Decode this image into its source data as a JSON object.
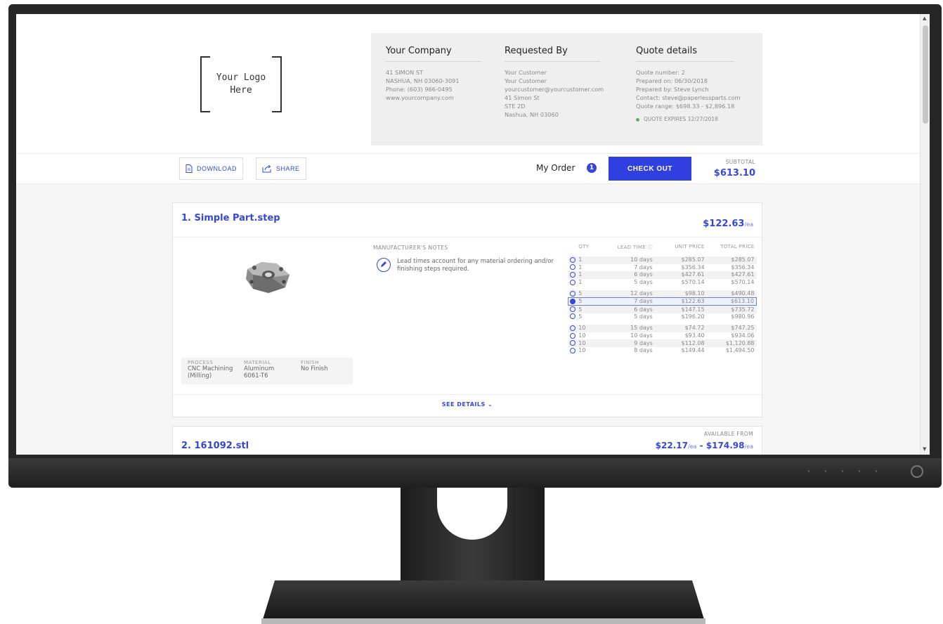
{
  "logo": {
    "line1": "Your Logo",
    "line2": "Here"
  },
  "company": {
    "heading": "Your Company",
    "lines": [
      "41 SIMON ST",
      "NASHUA, NH 03060-3091",
      "Phone: (603) 966-0495",
      "www.yourcompany.com"
    ]
  },
  "requested_by": {
    "heading": "Requested By",
    "lines": [
      "Your Customer",
      "Your Customer",
      "yourcustomer@yourcustomer.com",
      "41 Simon St",
      "STE 2D",
      "Nashua, NH 03060"
    ]
  },
  "quote_details": {
    "heading": "Quote details",
    "lines": [
      "Quote number: 2",
      "Prepared on: 06/30/2018",
      "Prepared by: Steve Lynch",
      "Contact: steve@paperlessparts.com",
      "Quote range: $698.33 - $2,896.18"
    ],
    "expires": "QUOTE EXPIRES 12/27/2018"
  },
  "toolbar": {
    "download_label": "DOWNLOAD",
    "share_label": "SHARE",
    "my_order_label": "My Order",
    "order_count": "1",
    "checkout_label": "CHECK OUT",
    "subtotal_label": "SUBTOTAL",
    "subtotal_value": "$613.10"
  },
  "colors": {
    "accent": "#3547d6",
    "checkout": "#2f3fe0",
    "expires_dot": "#5bb35b"
  },
  "part1": {
    "title": "1. Simple Part.step",
    "price": "$122.63",
    "unit": "/ea",
    "notes_heading": "MANUFACTURER'S NOTES",
    "notes_text": "Lead times account for any material ordering and/or finishing steps required.",
    "props": [
      {
        "key": "PROCESS",
        "value1": "CNC Machining",
        "value2": "(Milling)"
      },
      {
        "key": "MATERIAL",
        "value1": "Aluminum",
        "value2": "6061-T6"
      },
      {
        "key": "FINISH",
        "value1": "No Finish",
        "value2": ""
      }
    ],
    "table_headers": {
      "qty": "QTY",
      "lead": "LEAD TIME ⓘ",
      "unit": "UNIT PRICE",
      "total": "TOTAL PRICE"
    },
    "rows": [
      {
        "qty": "1",
        "lead": "10 days",
        "unit": "$285.07",
        "total": "$285.07",
        "selected": false
      },
      {
        "qty": "1",
        "lead": "7 days",
        "unit": "$356.34",
        "total": "$356.34",
        "selected": false
      },
      {
        "qty": "1",
        "lead": "6 days",
        "unit": "$427.61",
        "total": "$427.61",
        "selected": false
      },
      {
        "qty": "1",
        "lead": "5 days",
        "unit": "$570.14",
        "total": "$570.14",
        "selected": false
      },
      {
        "qty": "5",
        "lead": "12 days",
        "unit": "$98.10",
        "total": "$490.48",
        "selected": false
      },
      {
        "qty": "5",
        "lead": "7 days",
        "unit": "$122.63",
        "total": "$613.10",
        "selected": true
      },
      {
        "qty": "5",
        "lead": "6 days",
        "unit": "$147.15",
        "total": "$735.72",
        "selected": false
      },
      {
        "qty": "5",
        "lead": "5 days",
        "unit": "$196.20",
        "total": "$980.96",
        "selected": false
      },
      {
        "qty": "10",
        "lead": "15 days",
        "unit": "$74.72",
        "total": "$747.25",
        "selected": false
      },
      {
        "qty": "10",
        "lead": "10 days",
        "unit": "$93.40",
        "total": "$934.06",
        "selected": false
      },
      {
        "qty": "10",
        "lead": "9 days",
        "unit": "$112.08",
        "total": "$1,120.88",
        "selected": false
      },
      {
        "qty": "10",
        "lead": "8 days",
        "unit": "$149.44",
        "total": "$1,494.50",
        "selected": false
      }
    ],
    "see_details": "SEE DETAILS ⌄"
  },
  "part2": {
    "title": "2. 161092.stl",
    "available_label": "AVAILABLE FROM",
    "price_low": "$22.17",
    "price_high": "$174.98",
    "unit": "/ea",
    "separator": " - "
  }
}
